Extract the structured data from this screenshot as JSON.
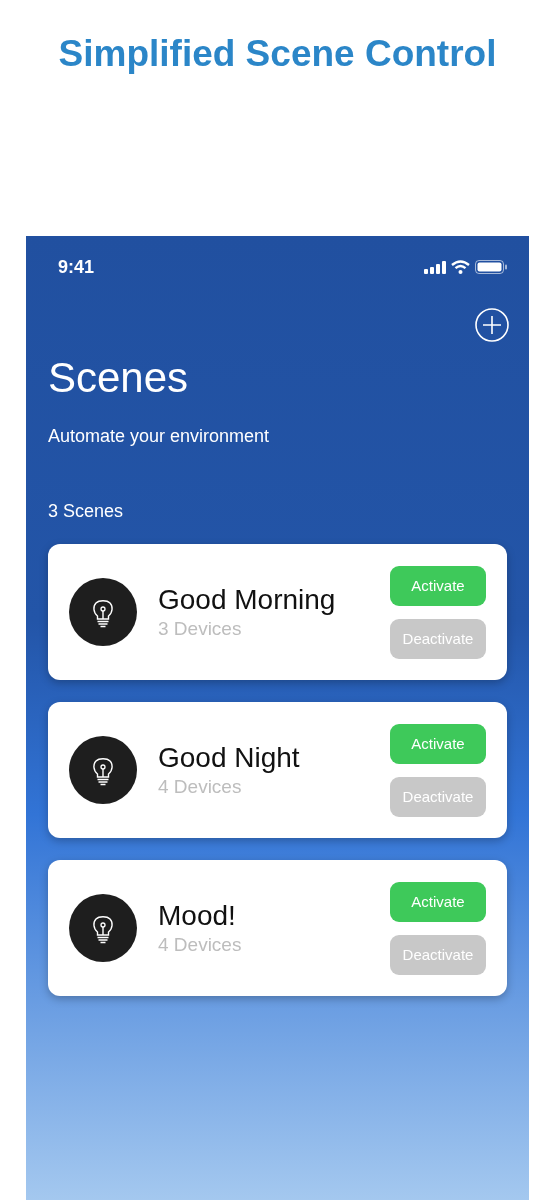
{
  "headline": "Simplified Scene Control",
  "status_bar": {
    "time": "9:41"
  },
  "header": {
    "title": "Scenes",
    "subtitle": "Automate your environment",
    "count": "3 Scenes"
  },
  "scenes": [
    {
      "name": "Good Morning",
      "devices": "3 Devices",
      "active": false,
      "activate": "Activate",
      "deactivate": "Deactivate"
    },
    {
      "name": "Good Night",
      "devices": "4 Devices",
      "active": false,
      "activate": "Activate",
      "deactivate": "Deactivate"
    },
    {
      "name": "Mood!",
      "devices": "4 Devices",
      "active": false,
      "activate": "Activate",
      "deactivate": "Deactivate"
    }
  ]
}
